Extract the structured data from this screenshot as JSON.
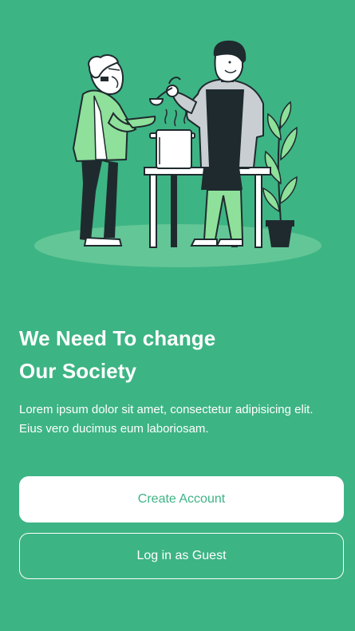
{
  "colors": {
    "background": "#3DB484",
    "primary_button_bg": "#FFFFFF",
    "primary_button_text": "#3DB484",
    "outline_button_border": "#FFFFFF"
  },
  "hero": {
    "image": "volunteer-serving-soup-illustration",
    "title_line1": "We Need To change",
    "title_line2": "Our Society",
    "description": "Lorem ipsum dolor sit amet, consectetur adipisicing elit. Eius vero ducimus eum laboriosam."
  },
  "actions": {
    "create_account_label": "Create Account",
    "guest_login_label": "Log in as Guest"
  }
}
